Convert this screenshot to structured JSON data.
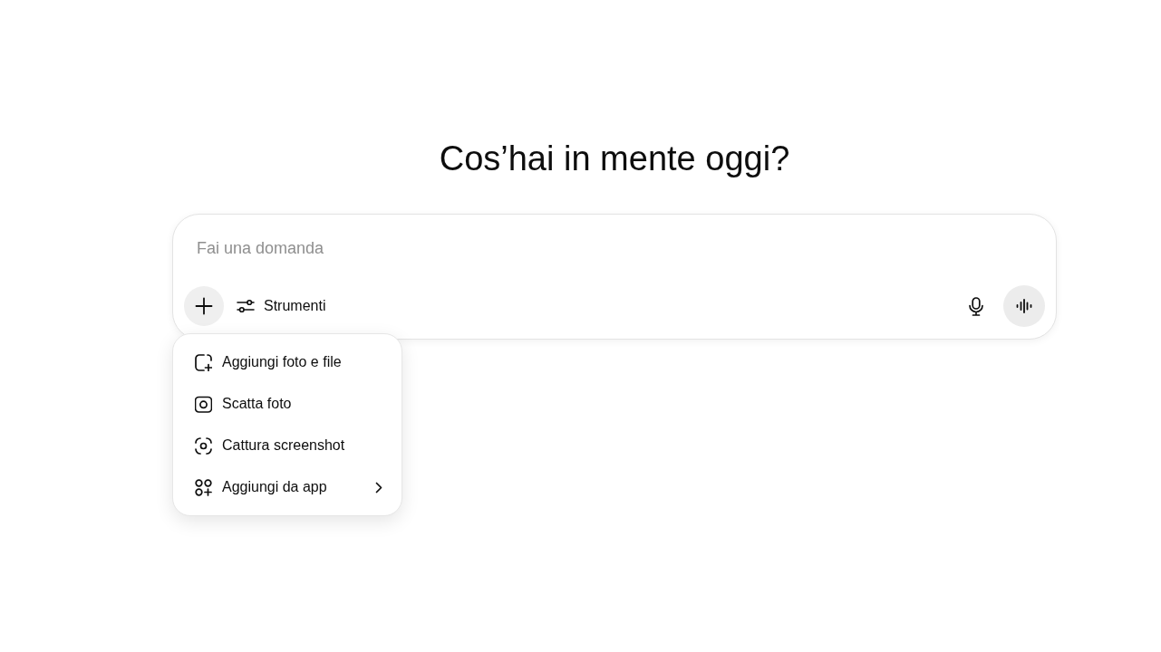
{
  "heading": "Cos’hai in mente oggi?",
  "composer": {
    "placeholder": "Fai una domanda",
    "attach_menu_open": true,
    "tools_button": {
      "label": "Strumenti"
    }
  },
  "attach_menu": {
    "items": [
      {
        "label": "Aggiungi foto e file",
        "has_submenu": false
      },
      {
        "label": "Scatta foto",
        "has_submenu": false
      },
      {
        "label": "Cattura screenshot",
        "has_submenu": false
      },
      {
        "label": "Aggiungi da app",
        "has_submenu": true
      }
    ]
  }
}
